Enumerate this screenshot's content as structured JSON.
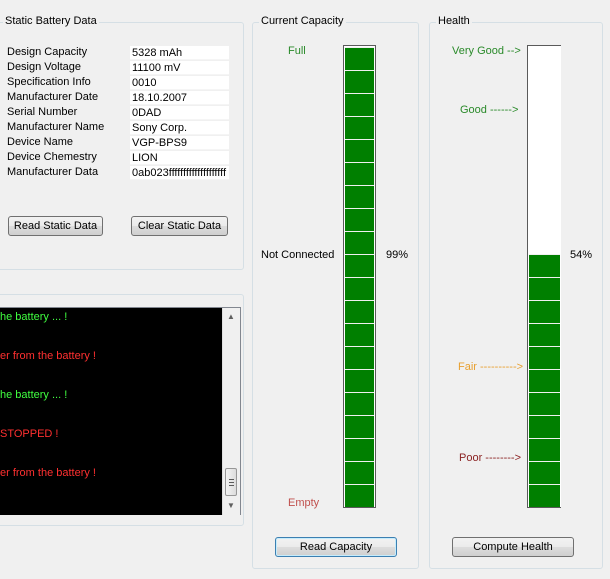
{
  "static_panel": {
    "title": "Static Battery Data",
    "fields": [
      {
        "label": "Design Capacity",
        "value": "5328 mAh"
      },
      {
        "label": "Design Voltage",
        "value": "11100 mV"
      },
      {
        "label": "Specification Info",
        "value": "0010"
      },
      {
        "label": "Manufacturer Date",
        "value": "18.10.2007"
      },
      {
        "label": "Serial Number",
        "value": "0DAD"
      },
      {
        "label": "Manufacturer Name",
        "value": "Sony Corp."
      },
      {
        "label": "Device Name",
        "value": "VGP-BPS9"
      },
      {
        "label": "Device Chemestry",
        "value": "LION"
      },
      {
        "label": "Manufacturer Data",
        "value": "0ab023ffffffffffffffffffff"
      }
    ],
    "read_button": "Read Static Data",
    "clear_button": "Clear Static Data"
  },
  "log": {
    "lines": [
      {
        "text": "he battery ... !",
        "color": "#40ff40"
      },
      {
        "text": "er from the battery !",
        "color": "#ff3030"
      },
      {
        "text": "he battery ... !",
        "color": "#40ff40"
      },
      {
        "text": "STOPPED !",
        "color": "#ff3030"
      },
      {
        "text": "er from the battery !",
        "color": "#ff3030"
      }
    ]
  },
  "capacity_panel": {
    "title": "Current Capacity",
    "full_label": "Full",
    "empty_label": "Empty",
    "status": "Not Connected",
    "percent_label": "99%",
    "fill_fraction": 1.0,
    "button": "Read Capacity",
    "colors": {
      "full": "#2a8a2a",
      "empty": "#c0504d",
      "bar": "#007f00"
    }
  },
  "health_panel": {
    "title": "Health",
    "percent_label": "54%",
    "fill_fraction": 0.54,
    "levels": {
      "very_good": "Very Good -->",
      "good": "Good ------>",
      "fair": "Fair ---------->",
      "poor": "Poor -------->"
    },
    "colors": {
      "very_good": "#2a8a2a",
      "good": "#2a8a2a",
      "fair": "#e8a030",
      "poor": "#8b2323"
    },
    "button": "Compute Health"
  }
}
